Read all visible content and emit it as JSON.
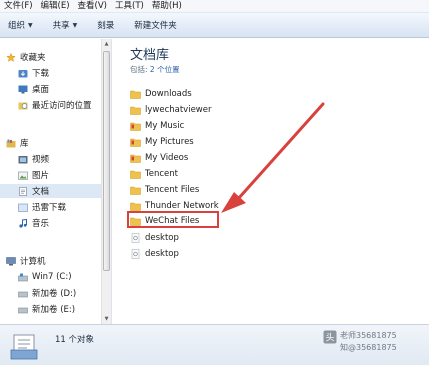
{
  "menu": [
    {
      "label": "文件(F)"
    },
    {
      "label": "编辑(E)"
    },
    {
      "label": "查看(V)"
    },
    {
      "label": "工具(T)"
    },
    {
      "label": "帮助(H)"
    }
  ],
  "toolbar": {
    "organize": "组织",
    "share": "共享",
    "burn": "刻录",
    "new_folder": "新建文件夹"
  },
  "nav": {
    "favorites": "收藏夹",
    "downloads": "下载",
    "desktop": "桌面",
    "recent": "最近访问的位置",
    "libraries": "库",
    "videos": "视频",
    "pictures": "图片",
    "documents": "文档",
    "thunder_downloads": "迅雷下载",
    "music": "音乐",
    "computer": "计算机",
    "drive_c": "Win7 (C:)",
    "drive_d": "新加卷 (D:)",
    "drive_e": "新加卷 (E:)"
  },
  "library": {
    "title": "文档库",
    "subtitle_prefix": "包括: ",
    "subtitle_link": "2 个位置"
  },
  "files": [
    {
      "name": "Downloads",
      "icon": "folder"
    },
    {
      "name": "lywechatviewer",
      "icon": "folder"
    },
    {
      "name": "My Music",
      "icon": "special-folder"
    },
    {
      "name": "My Pictures",
      "icon": "special-folder"
    },
    {
      "name": "My Videos",
      "icon": "special-folder"
    },
    {
      "name": "Tencent",
      "icon": "folder"
    },
    {
      "name": "Tencent Files",
      "icon": "folder"
    },
    {
      "name": "Thunder Network",
      "icon": "folder"
    },
    {
      "name": "WeChat Files",
      "icon": "folder"
    },
    {
      "name": "desktop",
      "icon": "settings-file"
    },
    {
      "name": "desktop",
      "icon": "settings-file"
    }
  ],
  "status": {
    "item_count": "11 个对象"
  },
  "watermark": {
    "line1": "老师35681875",
    "line2": "知@35681875"
  },
  "colors": {
    "annotation_red": "#d8413c",
    "folder_yellow": "#f0c24a",
    "selection_blue": "#dde8f6"
  }
}
